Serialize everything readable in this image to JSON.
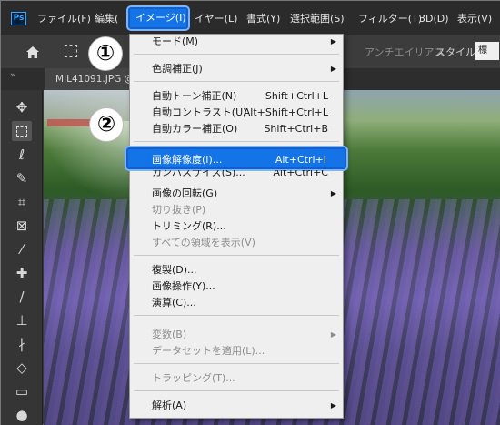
{
  "menubar": {
    "logo": "Ps",
    "items": [
      "ファイル(F)",
      "編集(",
      "イメージ(I)",
      "イヤー(L)",
      "書式(Y)",
      "選択範囲(S)",
      "フィルター(T)",
      "3D(D)",
      "表示(V)"
    ]
  },
  "options_bar": {
    "antialias_label": "アンチエイリアス",
    "style_label": "スタイル：",
    "style_value": "標"
  },
  "tab": {
    "collapse": "»",
    "document_title": "MIL41091.JPG @"
  },
  "callouts": [
    "①",
    "②"
  ],
  "menu": {
    "items": [
      {
        "label": "モード(M)",
        "arrow": "▶"
      },
      {
        "label": "色調補正(J)",
        "arrow": "▶"
      },
      {
        "label": "自動トーン補正(N)",
        "shortcut": "Shift+Ctrl+L"
      },
      {
        "label": "自動コントラスト(U)",
        "shortcut": "Alt+Shift+Ctrl+L"
      },
      {
        "label": "自動カラー補正(O)",
        "shortcut": "Shift+Ctrl+B"
      },
      {
        "label": "画像解像度(I)...",
        "shortcut": "Alt+Ctrl+I"
      },
      {
        "label": "カンバスサイズ(S)...",
        "shortcut": "Alt+Ctrl+C"
      },
      {
        "label": "画像の回転(G)",
        "arrow": "▶"
      },
      {
        "label": "切り抜き(P)"
      },
      {
        "label": "トリミング(R)..."
      },
      {
        "label": "すべての領域を表示(V)"
      },
      {
        "label": "複製(D)..."
      },
      {
        "label": "画像操作(Y)..."
      },
      {
        "label": "演算(C)..."
      },
      {
        "label": "変数(B)",
        "arrow": "▶"
      },
      {
        "label": "データセットを適用(L)..."
      },
      {
        "label": "トラッピング(T)..."
      },
      {
        "label": "解析(A)",
        "arrow": "▶"
      }
    ]
  },
  "colors": {
    "highlight": "#1473e6",
    "menu_bg": "#efefef",
    "app_bg": "#3a3a3a"
  }
}
